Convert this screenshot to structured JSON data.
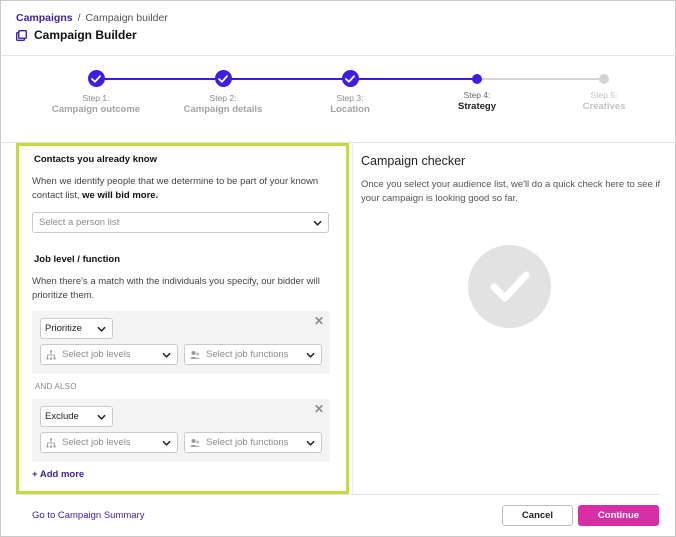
{
  "breadcrumb": {
    "root": "Campaigns",
    "separator": "/",
    "current": "Campaign builder"
  },
  "page": {
    "title": "Campaign Builder",
    "icon": "campaign-icon"
  },
  "steps": [
    {
      "number": "Step 1:",
      "name": "Campaign outcome",
      "state": "done"
    },
    {
      "number": "Step 2:",
      "name": "Campaign details",
      "state": "done"
    },
    {
      "number": "Step 3:",
      "name": "Location",
      "state": "done"
    },
    {
      "number": "Step 4:",
      "name": "Strategy",
      "state": "current"
    },
    {
      "number": "Step 5:",
      "name": "Creatives",
      "state": "future"
    }
  ],
  "contacts": {
    "title": "Contacts you already know",
    "text_prefix": "When we identify people that we determine to be part of your known contact list, ",
    "text_bold": "we will bid more.",
    "select_placeholder": "Select a person list"
  },
  "job": {
    "title": "Job level / function",
    "text": "When there's a match with the individuals you specify, our bidder will prioritize them.",
    "rules": [
      {
        "mode": "Prioritize",
        "levels_placeholder": "Select job levels",
        "functions_placeholder": "Select job functions"
      },
      {
        "mode": "Exclude",
        "levels_placeholder": "Select job levels",
        "functions_placeholder": "Select job functions"
      }
    ],
    "and_also": "AND ALSO",
    "add_more": "+ Add more"
  },
  "checker": {
    "title": "Campaign checker",
    "text": "Once you select your audience list, we'll do a quick check here to see if your campaign is looking good so far.",
    "icon": "checkmark-icon"
  },
  "footer": {
    "summary_link": "Go to Campaign Summary",
    "cancel_label": "Cancel",
    "continue_label": "Continue"
  },
  "colors": {
    "accent": "#3d1ee0",
    "highlight_border": "#c4dc3a",
    "continue_button": "#d62fa6",
    "link": "#3d1e9e"
  }
}
